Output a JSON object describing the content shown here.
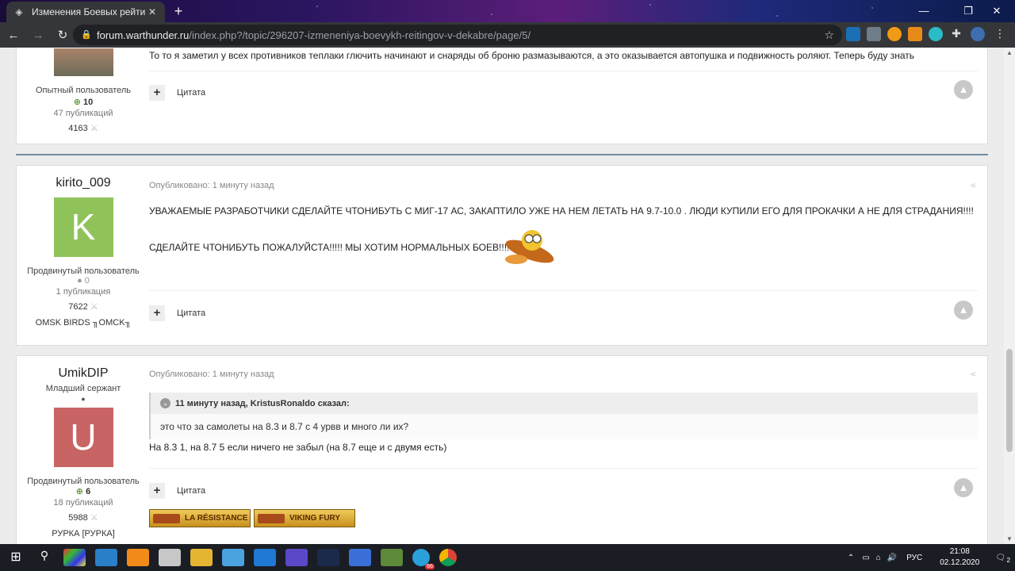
{
  "browser": {
    "tab_title": "Изменения Боевых рейтингов в",
    "url_host": "forum.warthunder.ru",
    "url_path": "/index.php?/topic/296207-izmeneniya-boevykh-reitingov-v-dekabre/page/5/"
  },
  "posts": [
    {
      "rank": "Опытный пользователь",
      "reputation": "10",
      "publications": "47 публикаций",
      "points": "4163",
      "body": "То то я заметил у всех противников теплаки глючить начинают и снаряды об броню размазываются, а это оказывается автопушка и подвижность роляют. Теперь буду знать",
      "quote_label": "Цитата"
    },
    {
      "username": "kirito_009",
      "avatar_letter": "K",
      "avatar_color": "#8fc35a",
      "rank": "Продвинутый пользователь",
      "reputation": "0",
      "publications": "1 публикация",
      "points": "7622",
      "clan": "OMSK BIRDS ╖OMCK╖",
      "published": "Опубликовано: 1 минуту назад",
      "body_line1": "УВАЖАЕМЫЕ РАЗРАБОТЧИКИ СДЕЛАЙТЕ ЧТОНИБУТЬ  С МИГ-17 АС, ЗАКАПТИЛО УЖЕ НА НЕМ ЛЕТАТЬ НА 9.7-10.0 . ЛЮДИ КУПИЛИ ЕГО ДЛЯ ПРОКАЧКИ А НЕ ДЛЯ СТРАДАНИЯ!!!!",
      "body_line2": "СДЕЛАЙТЕ ЧТОНИБУТЬ ПОЖАЛУЙСТА!!!!! МЫ ХОТИМ НОРМАЛЬНЫХ БОЕВ!!!!",
      "quote_label": "Цитата"
    },
    {
      "username": "UmikDIP",
      "title": "Младший сержант",
      "avatar_letter": "U",
      "avatar_color": "#c86464",
      "rank": "Продвинутый пользователь",
      "reputation": "6",
      "publications": "18 публикаций",
      "points": "5988",
      "clan": "РУРКА [РУРКА]",
      "published": "Опубликовано: 1 минуту назад",
      "quoted_header": "11 минуту назад, KristusRonaldo сказал:",
      "quoted_text": "это что за самолеты на 8.3 и 8.7 с 4 урвв и много ли их?",
      "body": "На 8.3 1, на 8.7 5 если ничего не забыл (на 8.7 еще и с двумя есть)",
      "quote_label": "Цитата",
      "badges": [
        "LA RÉSISTANCE",
        "VIKING FURY"
      ]
    }
  ],
  "taskbar": {
    "language": "РУС",
    "time": "21:08",
    "date": "02.12.2020",
    "notifications": "2",
    "telegram_badge": "66"
  }
}
